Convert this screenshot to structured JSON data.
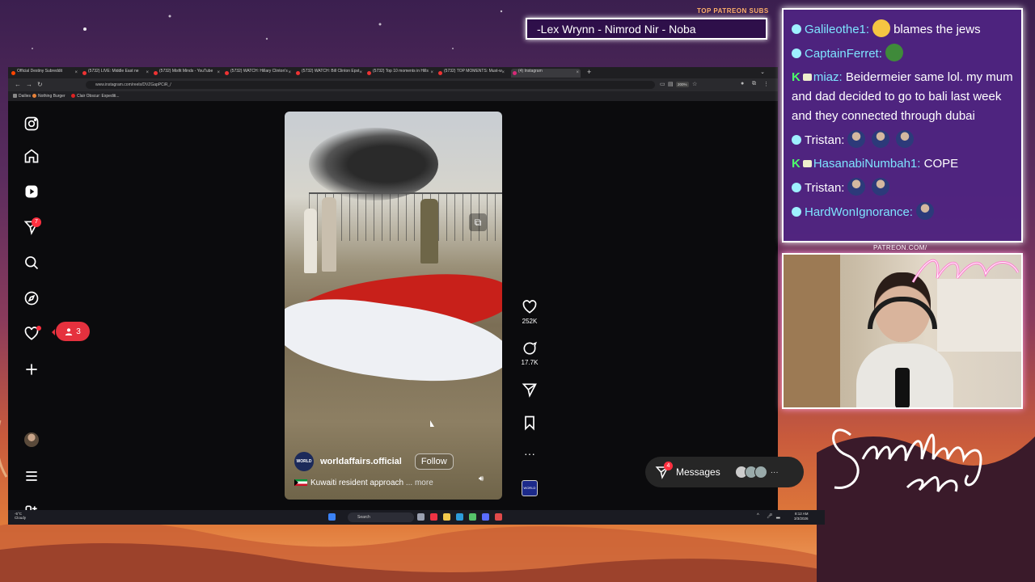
{
  "stream_overlay": {
    "subs_heading": "TOP PATREON SUBS",
    "subs_names": "-Lex Wrynn - Nimrod Nir - Noba",
    "patreon_label": "PATREON.COM/",
    "accent_color": "#ffffff",
    "chat_bg": "#4e2482",
    "chat_user_color": "#7ee4ff"
  },
  "chat": {
    "messages": [
      {
        "user": "Galileothe1:",
        "text": "blames the jews"
      },
      {
        "user": "CaptainFerret:",
        "text": ""
      },
      {
        "user": "miaz:",
        "text": "Beidermeier same lol. my mum and dad decided to go to bali last week and they connected through dubai"
      },
      {
        "user": "Tristan:",
        "text": ""
      },
      {
        "user": "HasanabiNumbah1:",
        "text": "COPE"
      },
      {
        "user": "Tristan:",
        "text": ""
      },
      {
        "user": "HardWonIgnorance:",
        "text": ""
      }
    ]
  },
  "browser": {
    "tabs": [
      {
        "label": "Official Destiny Subreddit"
      },
      {
        "label": "(5732) LIVE: Middle East ne"
      },
      {
        "label": "(5732) Misfit Minds - YouTube"
      },
      {
        "label": "(5732) WATCH: Hillary Clinton's"
      },
      {
        "label": "(5732) WATCH: Bill Clinton Epst"
      },
      {
        "label": "(5732) Top 10 moments in Hills"
      },
      {
        "label": "(5732) TOP MOMENTS: Must-w"
      },
      {
        "label": "(4) Instagram"
      }
    ],
    "url": "www.instagram.com/reels/DVZGapPCiR_/",
    "zoom": "200%",
    "bookmarks": [
      {
        "label": "Dailies"
      },
      {
        "label": "Nothing Burger"
      },
      {
        "label": "Clair Obscur: Expediti..."
      }
    ]
  },
  "instagram": {
    "sidebar": {
      "notifications_count": "7",
      "follow_requests_count": "3"
    },
    "reel": {
      "username": "worldaffairs.official",
      "avatar_text": "WORLD",
      "follow_label": "Follow",
      "caption": "Kuwaiti resident approach",
      "more_label": "... more",
      "likes": "252K",
      "comments": "17.7K",
      "audio_label": "WORLD"
    },
    "messages": {
      "label": "Messages",
      "badge": "4",
      "more": "···"
    }
  },
  "taskbar": {
    "weather_temp": "-5°C",
    "weather_text": "Cloudy",
    "search_placeholder": "Search",
    "time": "8:12 AM",
    "date": "3/3/2026"
  }
}
